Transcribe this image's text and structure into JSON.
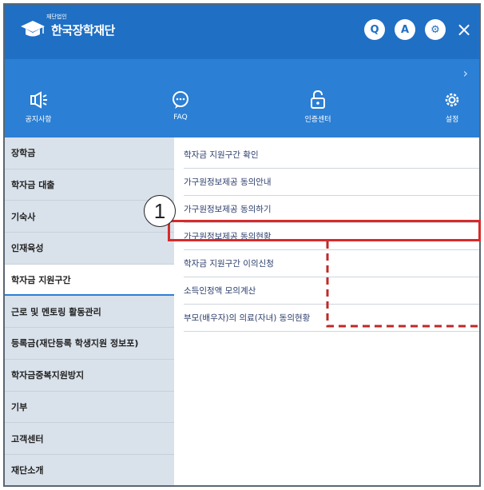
{
  "header": {
    "logo_small": "재단법인",
    "logo_text": "한국장학재단",
    "icons": [
      {
        "name": "search-icon",
        "glyph": "Q"
      },
      {
        "name": "user-icon",
        "glyph": "A"
      },
      {
        "name": "settings-icon",
        "glyph": "⚙"
      }
    ],
    "close_glyph": "×"
  },
  "nav_chevron": "›",
  "quick_menu": [
    {
      "name": "notice",
      "label": "공지사항"
    },
    {
      "name": "faq",
      "label": "FAQ"
    },
    {
      "name": "cert",
      "label": "인증센터"
    },
    {
      "name": "settings",
      "label": "설정"
    }
  ],
  "sidebar": {
    "items": [
      {
        "label": "장학금",
        "active": false
      },
      {
        "label": "학자금 대출",
        "active": false
      },
      {
        "label": "기숙사",
        "active": false
      },
      {
        "label": "인재육성",
        "active": false
      },
      {
        "label": "학자금 지원구간",
        "active": true
      },
      {
        "label": "근로 및 멘토링 활동관리",
        "active": false
      },
      {
        "label": "등록금(재단등록 학생지원 정보포)",
        "active": false
      },
      {
        "label": "학자금중복지원방지",
        "active": false
      },
      {
        "label": "기부",
        "active": false
      },
      {
        "label": "고객센터",
        "active": false
      },
      {
        "label": "재단소개",
        "active": false
      }
    ]
  },
  "submenu": {
    "items": [
      {
        "label": "학자금 지원구간 확인"
      },
      {
        "label": "가구원정보제공 동의안내"
      },
      {
        "label": "가구원정보제공 동의하기"
      },
      {
        "label": "가구원정보제공 동의현황"
      },
      {
        "label": "학자금 지원구간 이의신청"
      },
      {
        "label": "소득인정액 모의계산"
      },
      {
        "label": "부모(배우자)의 의료(자녀) 동의현황"
      }
    ],
    "highlighted_index": 3
  },
  "annotation": {
    "marker": "1"
  },
  "colors": {
    "header": "#1f6fc4",
    "bluebar": "#2b7fd4",
    "sidebar": "#d9e1ea",
    "highlight": "#d72a2a"
  }
}
